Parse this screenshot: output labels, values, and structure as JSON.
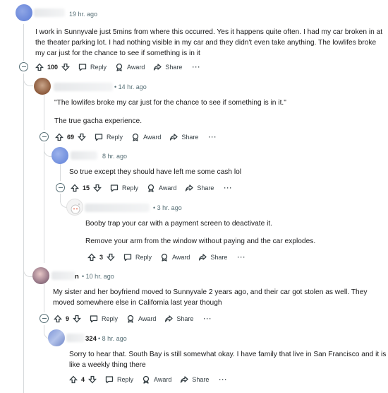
{
  "comments": [
    {
      "author": "",
      "time": "19 hr. ago",
      "body": [
        "I work in Sunnyvale just 5mins from where this occurred. Yes it happens quite often. I had my car broken in at",
        "the theater parking lot. I had nothing visible in my car and they didn't even take anything. The lowlifes broke",
        "my car just for the chance to see if something is in it"
      ],
      "score": "100"
    },
    {
      "author": "",
      "time": "14 hr. ago",
      "body": [
        "\"The lowlifes broke my car just for the chance to see if something is in it.\""
      ],
      "body2": [
        "The true gacha experience."
      ],
      "score": "69"
    },
    {
      "author": "",
      "time": "8 hr. ago",
      "body": [
        "So true except they should have left me some cash lol"
      ],
      "score": "15"
    },
    {
      "author": "",
      "time": "3 hr. ago",
      "body": [
        "Booby trap your car with a payment screen to deactivate it."
      ],
      "body2": [
        "Remove your arm from the window without paying and the car explodes."
      ],
      "score": "3"
    },
    {
      "author": "n",
      "time": "10 hr. ago",
      "body": [
        "My sister and her boyfriend moved to Sunnyvale 2 years ago, and their car got stolen as well. They",
        "moved somewhere else in California last year though"
      ],
      "score": "9"
    },
    {
      "author": "324",
      "time": "8 hr. ago",
      "body": [
        "Sorry to hear that. South Bay is still somewhat okay. I have family that live in San Francisco and it is",
        "like a weekly thing there"
      ],
      "score": "4"
    }
  ],
  "actions": {
    "reply": "Reply",
    "award": "Award",
    "share": "Share",
    "more": "···"
  },
  "separator": "•",
  "colors": {
    "thread_line": "#d7dadc",
    "meta": "#576f76",
    "text": "#1a1a1b"
  }
}
